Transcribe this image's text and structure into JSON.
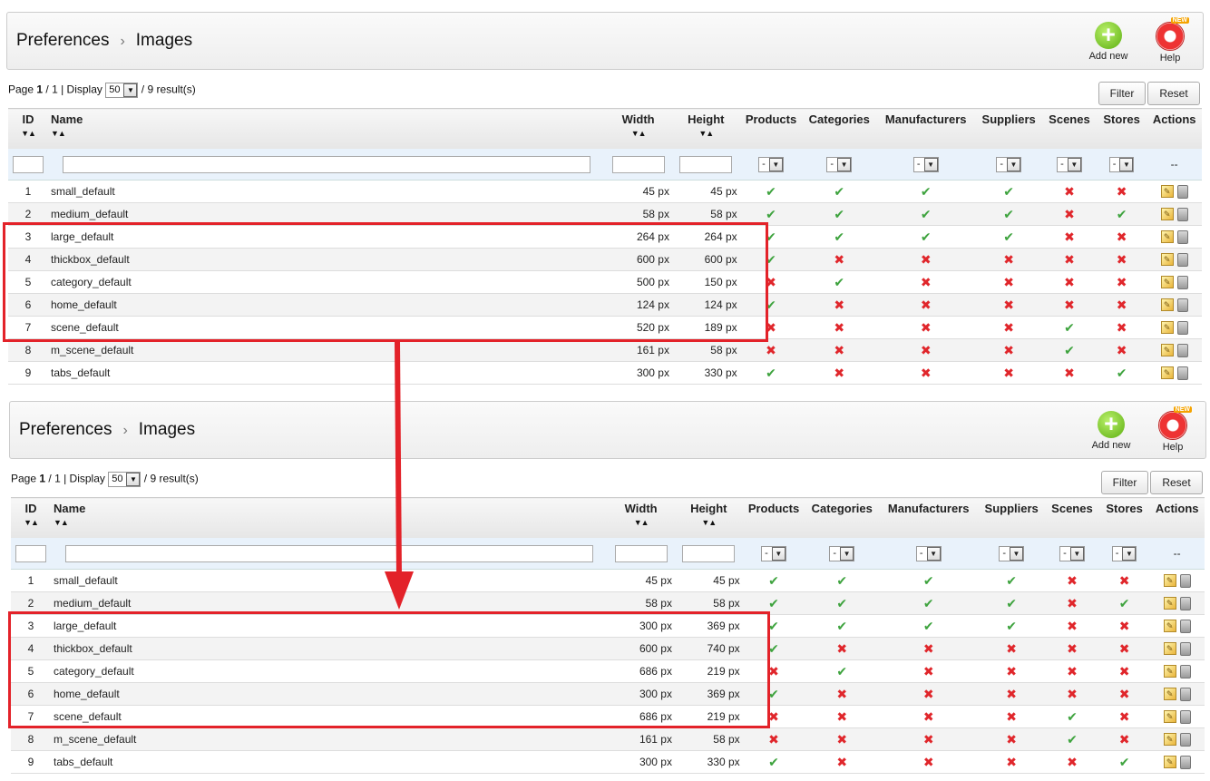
{
  "panels": [
    {
      "breadcrumb": [
        "Preferences",
        "Images"
      ],
      "add_new_label": "Add new",
      "help_label": "Help",
      "help_badge": "NEW",
      "pagination": {
        "page_prefix": "Page",
        "page_current": "1",
        "page_sep": " / 1 | Display ",
        "per_page": "50",
        "results": " / 9 result(s)"
      },
      "filter_label": "Filter",
      "reset_label": "Reset",
      "columns": [
        "ID",
        "Name",
        "Width",
        "Height",
        "Products",
        "Categories",
        "Manufacturers",
        "Suppliers",
        "Scenes",
        "Stores",
        "Actions"
      ],
      "filter_select": "-",
      "actions_filter": "--",
      "rows": [
        {
          "id": "1",
          "name": "small_default",
          "width": "45 px",
          "height": "45 px",
          "flags": [
            1,
            1,
            1,
            1,
            0,
            0
          ]
        },
        {
          "id": "2",
          "name": "medium_default",
          "width": "58 px",
          "height": "58 px",
          "flags": [
            1,
            1,
            1,
            1,
            0,
            1
          ]
        },
        {
          "id": "3",
          "name": "large_default",
          "width": "264 px",
          "height": "264 px",
          "flags": [
            1,
            1,
            1,
            1,
            0,
            0
          ]
        },
        {
          "id": "4",
          "name": "thickbox_default",
          "width": "600 px",
          "height": "600 px",
          "flags": [
            1,
            0,
            0,
            0,
            0,
            0
          ]
        },
        {
          "id": "5",
          "name": "category_default",
          "width": "500 px",
          "height": "150 px",
          "flags": [
            0,
            1,
            0,
            0,
            0,
            0
          ]
        },
        {
          "id": "6",
          "name": "home_default",
          "width": "124 px",
          "height": "124 px",
          "flags": [
            1,
            0,
            0,
            0,
            0,
            0
          ]
        },
        {
          "id": "7",
          "name": "scene_default",
          "width": "520 px",
          "height": "189 px",
          "flags": [
            0,
            0,
            0,
            0,
            1,
            0
          ]
        },
        {
          "id": "8",
          "name": "m_scene_default",
          "width": "161 px",
          "height": "58 px",
          "flags": [
            0,
            0,
            0,
            0,
            1,
            0
          ]
        },
        {
          "id": "9",
          "name": "tabs_default",
          "width": "300 px",
          "height": "330 px",
          "flags": [
            1,
            0,
            0,
            0,
            0,
            1
          ]
        }
      ]
    },
    {
      "breadcrumb": [
        "Preferences",
        "Images"
      ],
      "add_new_label": "Add new",
      "help_label": "Help",
      "help_badge": "NEW",
      "pagination": {
        "page_prefix": "Page",
        "page_current": "1",
        "page_sep": " / 1 | Display ",
        "per_page": "50",
        "results": " / 9 result(s)"
      },
      "filter_label": "Filter",
      "reset_label": "Reset",
      "columns": [
        "ID",
        "Name",
        "Width",
        "Height",
        "Products",
        "Categories",
        "Manufacturers",
        "Suppliers",
        "Scenes",
        "Stores",
        "Actions"
      ],
      "filter_select": "-",
      "actions_filter": "--",
      "rows": [
        {
          "id": "1",
          "name": "small_default",
          "width": "45 px",
          "height": "45 px",
          "flags": [
            1,
            1,
            1,
            1,
            0,
            0
          ]
        },
        {
          "id": "2",
          "name": "medium_default",
          "width": "58 px",
          "height": "58 px",
          "flags": [
            1,
            1,
            1,
            1,
            0,
            1
          ]
        },
        {
          "id": "3",
          "name": "large_default",
          "width": "300 px",
          "height": "369 px",
          "flags": [
            1,
            1,
            1,
            1,
            0,
            0
          ]
        },
        {
          "id": "4",
          "name": "thickbox_default",
          "width": "600 px",
          "height": "740 px",
          "flags": [
            1,
            0,
            0,
            0,
            0,
            0
          ]
        },
        {
          "id": "5",
          "name": "category_default",
          "width": "686 px",
          "height": "219 px",
          "flags": [
            0,
            1,
            0,
            0,
            0,
            0
          ]
        },
        {
          "id": "6",
          "name": "home_default",
          "width": "300 px",
          "height": "369 px",
          "flags": [
            1,
            0,
            0,
            0,
            0,
            0
          ]
        },
        {
          "id": "7",
          "name": "scene_default",
          "width": "686 px",
          "height": "219 px",
          "flags": [
            0,
            0,
            0,
            0,
            1,
            0
          ]
        },
        {
          "id": "8",
          "name": "m_scene_default",
          "width": "161 px",
          "height": "58 px",
          "flags": [
            0,
            0,
            0,
            0,
            1,
            0
          ]
        },
        {
          "id": "9",
          "name": "tabs_default",
          "width": "300 px",
          "height": "330 px",
          "flags": [
            1,
            0,
            0,
            0,
            0,
            1
          ]
        }
      ]
    }
  ],
  "annotation_color": "#e32229",
  "icons": {
    "yes": "check-icon",
    "no": "cross-icon",
    "edit": "edit-icon",
    "delete": "trash-icon"
  }
}
